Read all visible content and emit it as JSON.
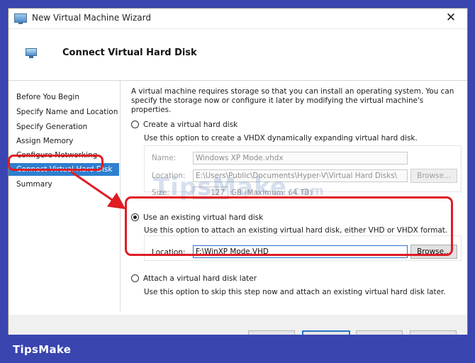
{
  "window": {
    "title": "New Virtual Machine Wizard",
    "close_glyph": "✕"
  },
  "header": {
    "title": "Connect Virtual Hard Disk"
  },
  "nav": {
    "items": [
      {
        "label": "Before You Begin",
        "active": false
      },
      {
        "label": "Specify Name and Location",
        "active": false
      },
      {
        "label": "Specify Generation",
        "active": false
      },
      {
        "label": "Assign Memory",
        "active": false
      },
      {
        "label": "Configure Networking",
        "active": false
      },
      {
        "label": "Connect Virtual Hard Disk",
        "active": true
      },
      {
        "label": "Summary",
        "active": false
      }
    ]
  },
  "main": {
    "intro": "A virtual machine requires storage so that you can install an operating system. You can specify the storage now or configure it later by modifying the virtual machine's properties.",
    "create_option": {
      "label": "Create a virtual hard disk",
      "description": "Use this option to create a VHDX dynamically expanding virtual hard disk.",
      "name_label": "Name:",
      "name_value": "Windows XP Mode.vhdx",
      "location_label": "Location:",
      "location_value": "E:\\Users\\Public\\Documents\\Hyper-V\\Virtual Hard Disks\\",
      "browse_label": "Browse...",
      "size_label": "Size:",
      "size_value": "127",
      "size_unit": "GB (Maximum: 64 TB)"
    },
    "existing_option": {
      "label": "Use an existing virtual hard disk",
      "description": "Use this option to attach an existing virtual hard disk, either VHD or VHDX format.",
      "location_label": "Location:",
      "location_value": "F:\\WinXP Mode.VHD",
      "browse_label": "Browse..."
    },
    "later_option": {
      "label": "Attach a virtual hard disk later",
      "description": "Use this option to skip this step now and attach an existing virtual hard disk later."
    },
    "selected_option": "existing"
  },
  "watermark": {
    "text": "TipsMake",
    "suffix": ".com"
  },
  "brand": {
    "text": "TipsMake"
  },
  "colors": {
    "accent": "#2f7fd0",
    "highlight": "#e01c24",
    "background": "#3a45b0"
  }
}
